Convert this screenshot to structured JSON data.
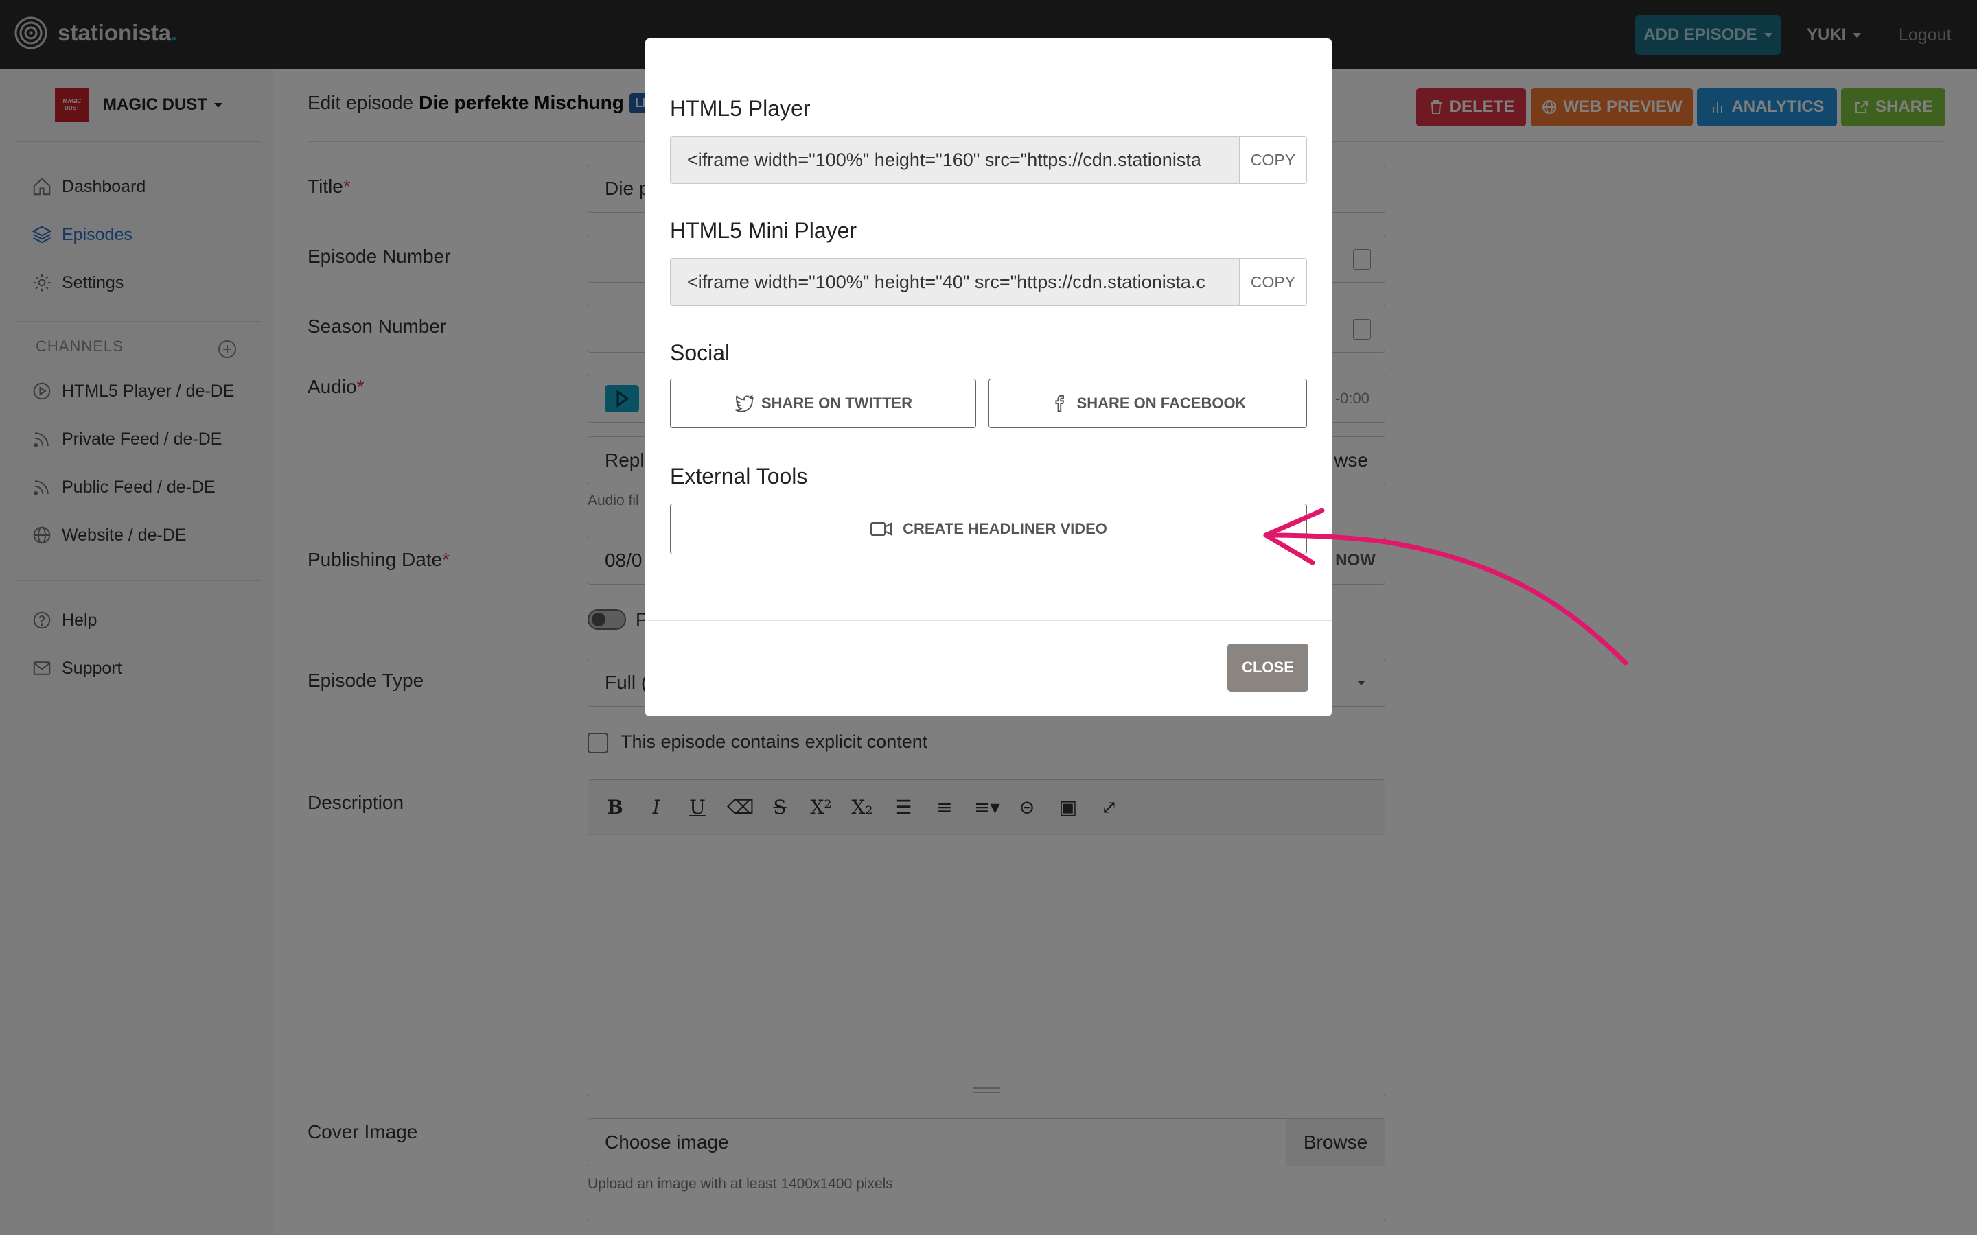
{
  "app": {
    "brand_name": "stationista",
    "brand_dot": "."
  },
  "topbar": {
    "add_episode": "ADD EPISODE",
    "user": "YUKI",
    "logout": "Logout"
  },
  "sidebar": {
    "channel_logo_text": "MAGIC DUST",
    "channel_name": "MAGIC DUST",
    "nav": [
      {
        "label": "Dashboard",
        "icon": "home-icon"
      },
      {
        "label": "Episodes",
        "icon": "layers-icon",
        "active": true
      },
      {
        "label": "Settings",
        "icon": "gear-icon"
      }
    ],
    "channels_heading": "CHANNELS",
    "channels": [
      {
        "label": "HTML5 Player / de-DE",
        "icon": "play-circle-icon"
      },
      {
        "label": "Private Feed / de-DE",
        "icon": "rss-icon"
      },
      {
        "label": "Public Feed / de-DE",
        "icon": "rss-icon"
      },
      {
        "label": "Website / de-DE",
        "icon": "globe-icon"
      }
    ],
    "help": "Help",
    "support": "Support"
  },
  "page": {
    "edit_prefix": "Edit episode",
    "episode_title": "Die perfekte Mischung",
    "badge": "LIV",
    "actions": {
      "delete": "DELETE",
      "web_preview": "WEB PREVIEW",
      "analytics": "ANALYTICS",
      "share": "SHARE"
    }
  },
  "form": {
    "title_label": "Title",
    "title_value": "Die p",
    "episode_number_label": "Episode Number",
    "season_number_label": "Season Number",
    "audio_label": "Audio",
    "audio_time": "-0:00",
    "audio_replace": "Repl",
    "audio_browse": "wse",
    "audio_help": "Audio fil",
    "publishing_date_label": "Publishing Date",
    "publishing_date_value": "08/0",
    "now_button": "NOW",
    "toggle_label": "P",
    "episode_type_label": "Episode Type",
    "episode_type_value": "Full (",
    "explicit_label": "This episode contains explicit content",
    "description_label": "Description",
    "cover_image_label": "Cover Image",
    "cover_image_placeholder": "Choose image",
    "cover_browse": "Browse",
    "cover_help": "Upload an image with at least 1400x1400 pixels"
  },
  "modal": {
    "html5_player_heading": "HTML5 Player",
    "html5_player_code": "<iframe width=\"100%\" height=\"160\" src=\"https://cdn.stationista",
    "mini_player_heading": "HTML5 Mini Player",
    "mini_player_code": "<iframe width=\"100%\" height=\"40\" src=\"https://cdn.stationista.c",
    "copy_label": "COPY",
    "social_heading": "Social",
    "share_twitter": "SHARE ON TWITTER",
    "share_facebook": "SHARE ON FACEBOOK",
    "external_tools_heading": "External Tools",
    "create_headliner": "CREATE HEADLINER VIDEO",
    "close": "CLOSE"
  },
  "colors": {
    "annotation_arrow": "#e0186c",
    "brand_accent": "#17a2c8"
  }
}
